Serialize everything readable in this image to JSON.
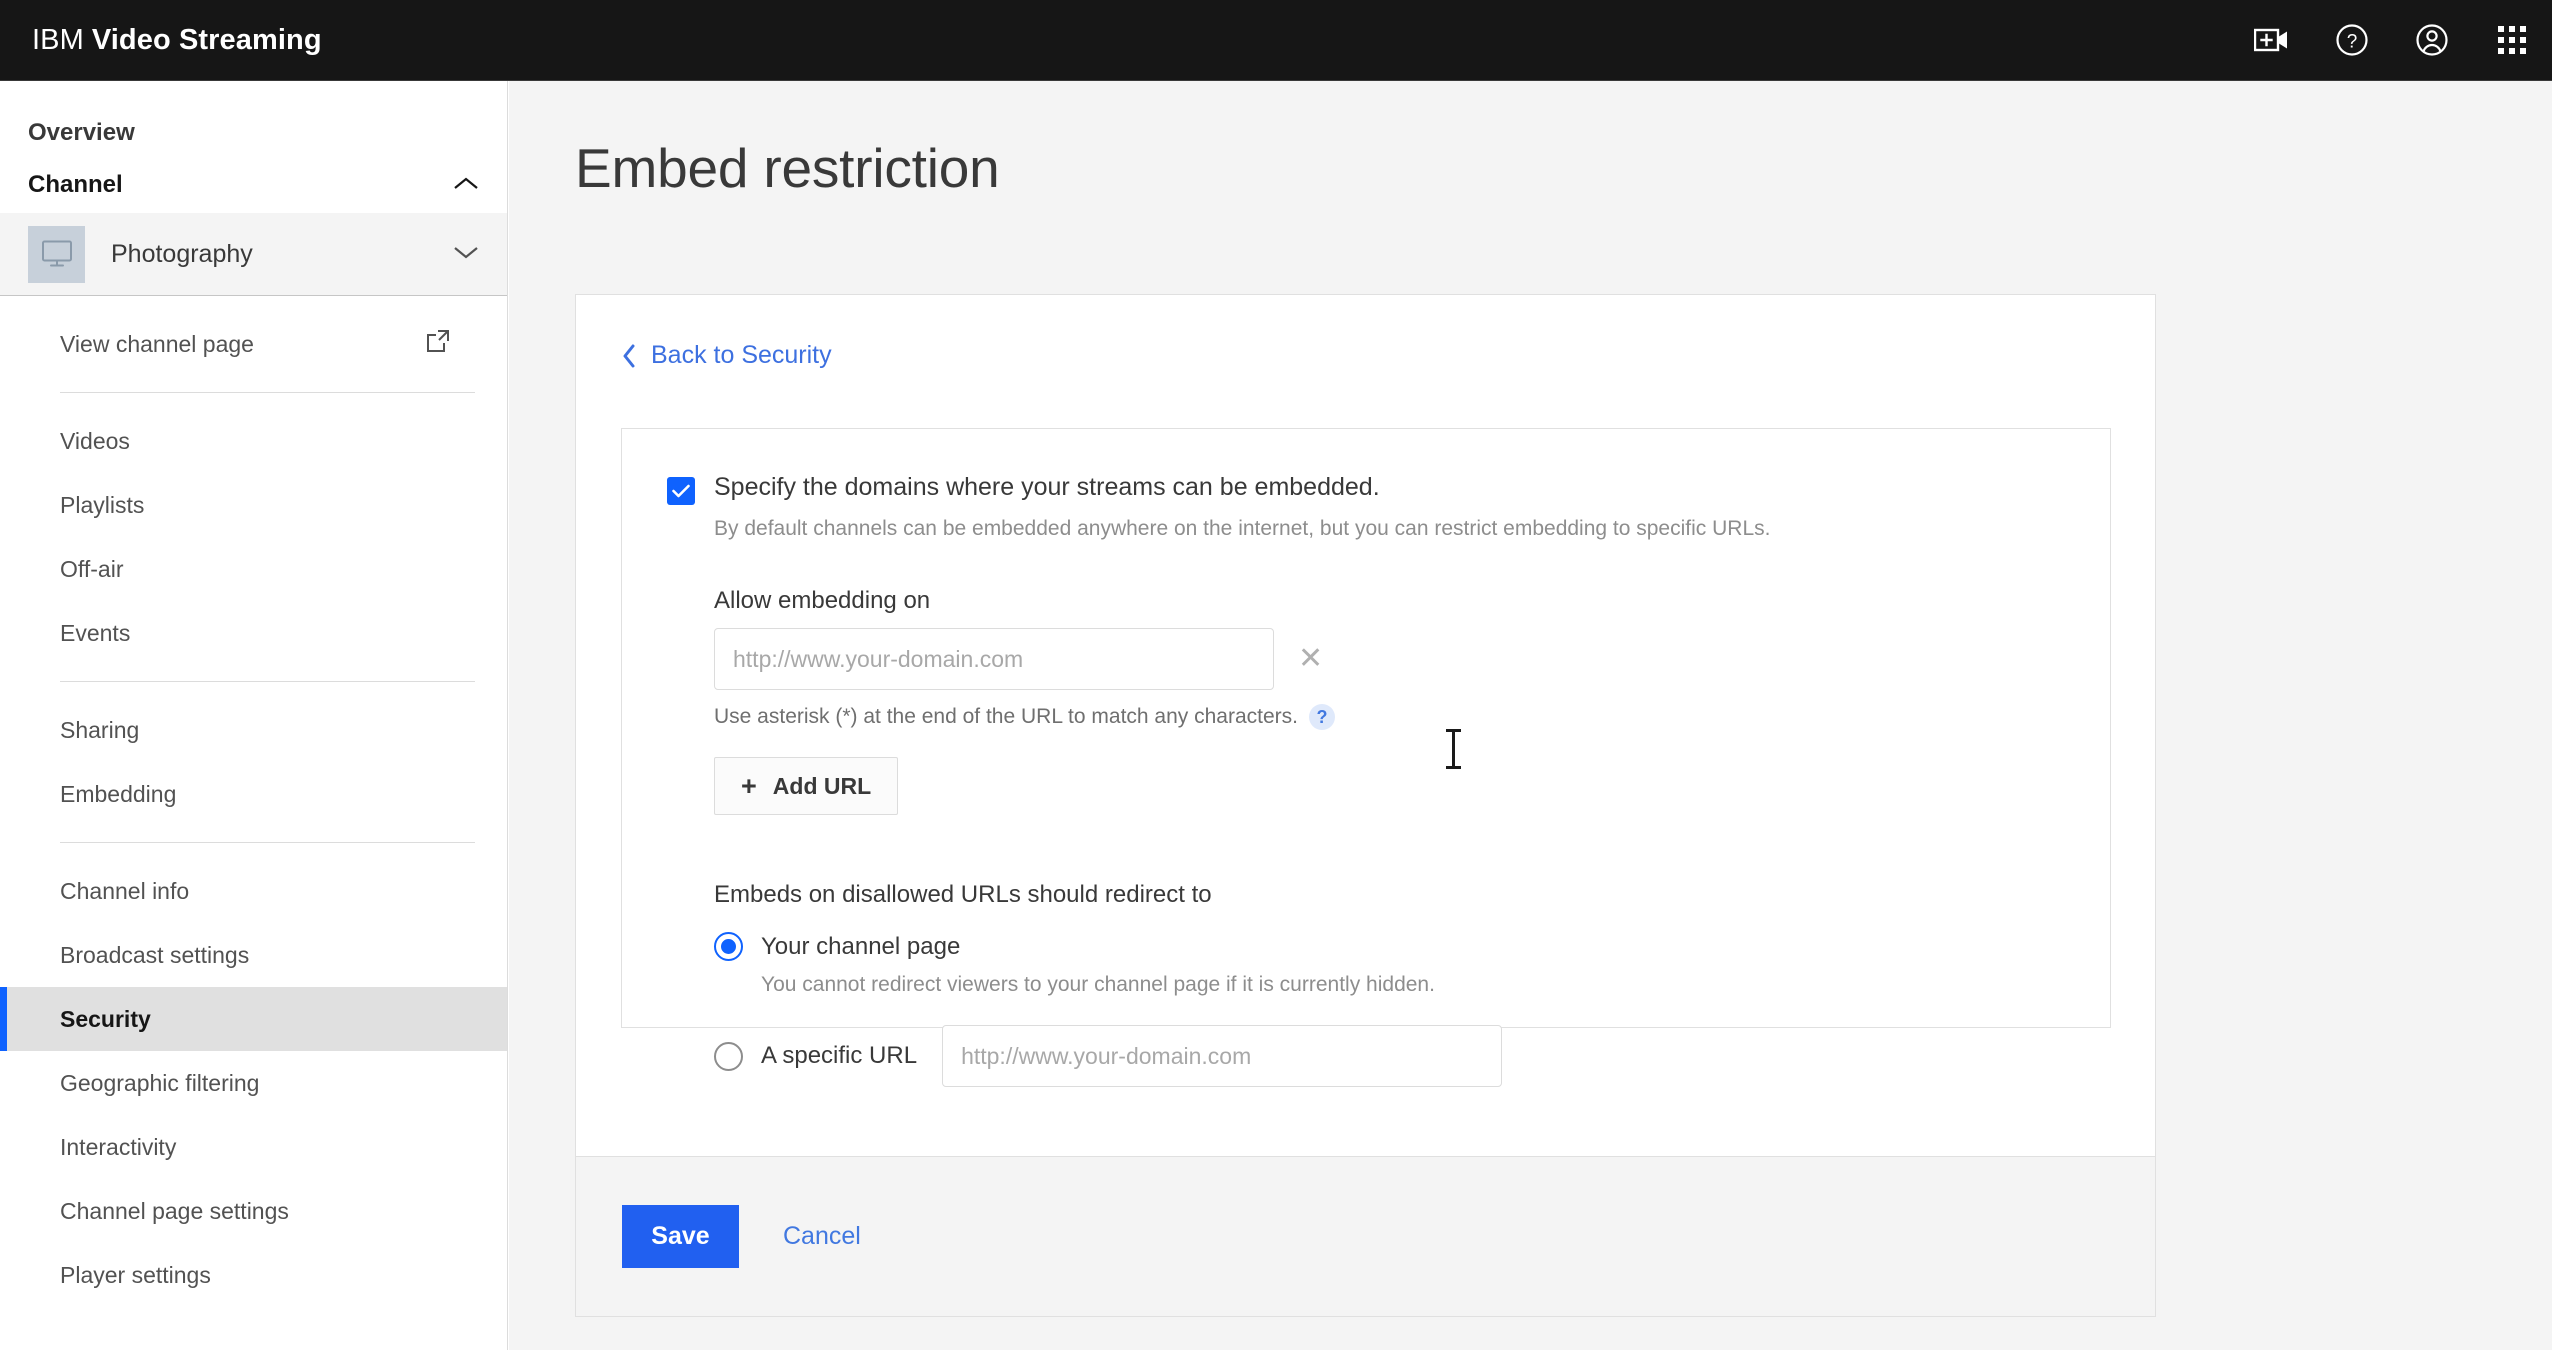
{
  "header": {
    "brand_prefix": "IBM",
    "brand_product": "Video Streaming",
    "actions": [
      {
        "name": "add-video-icon",
        "label": "Add video"
      },
      {
        "name": "help-icon",
        "label": "Help"
      },
      {
        "name": "user-account-icon",
        "label": "Account"
      },
      {
        "name": "app-switcher-icon",
        "label": "App switcher"
      }
    ]
  },
  "sidebar": {
    "overview_label": "Overview",
    "channel_label": "Channel",
    "channel_chevron": "chevron-up-icon",
    "current_channel": "Photography",
    "current_channel_chevron": "chevron-down-icon",
    "groups": [
      {
        "items": [
          {
            "label": "View channel page",
            "icon": "external-link-icon",
            "active": false
          }
        ]
      },
      {
        "items": [
          {
            "label": "Videos",
            "active": false
          },
          {
            "label": "Playlists",
            "active": false
          },
          {
            "label": "Off-air",
            "active": false
          },
          {
            "label": "Events",
            "active": false
          }
        ]
      },
      {
        "items": [
          {
            "label": "Sharing",
            "active": false
          },
          {
            "label": "Embedding",
            "active": false
          }
        ]
      },
      {
        "items": [
          {
            "label": "Channel info",
            "active": false
          },
          {
            "label": "Broadcast settings",
            "active": false
          },
          {
            "label": "Security",
            "active": true
          },
          {
            "label": "Geographic filtering",
            "active": false
          },
          {
            "label": "Interactivity",
            "active": false
          },
          {
            "label": "Channel page settings",
            "active": false
          },
          {
            "label": "Player settings",
            "active": false
          }
        ]
      }
    ]
  },
  "main": {
    "page_title": "Embed restriction",
    "back_link": "Back to Security",
    "checkbox": {
      "checked": true,
      "label": "Specify the domains where your streams can be embedded.",
      "help": "By default channels can be embedded anywhere on the internet, but you can restrict embedding to specific URLs."
    },
    "allow_embedding": {
      "label": "Allow embedding on",
      "input_value": "",
      "input_placeholder": "http://www.your-domain.com",
      "clear_glyph": "✕",
      "hint": "Use asterisk (*) at the end of the URL to match any characters.",
      "hint_icon_glyph": "?",
      "add_url_label": "Add URL",
      "add_url_plus": "+"
    },
    "redirect": {
      "title": "Embeds on disallowed URLs should redirect to",
      "options": [
        {
          "label": "Your channel page",
          "selected": true,
          "help": "You cannot redirect viewers to your channel page if it is currently hidden."
        },
        {
          "label": "A specific URL",
          "selected": false,
          "input_value": "",
          "input_placeholder": "http://www.your-domain.com"
        }
      ]
    },
    "footer": {
      "save_label": "Save",
      "cancel_label": "Cancel"
    }
  },
  "colors": {
    "accent_blue": "#0f62fe",
    "link_blue": "#4178e0",
    "save_blue": "#2160f0",
    "header_black": "#161616",
    "page_bg": "#f4f4f4"
  }
}
